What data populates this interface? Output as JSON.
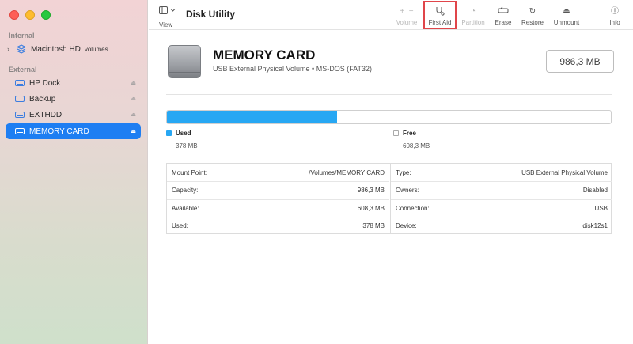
{
  "sidebar": {
    "internal_label": "Internal",
    "external_label": "External",
    "internal_items": [
      {
        "label": "Macintosh HD",
        "sub": "volumes"
      }
    ],
    "external_items": [
      {
        "label": "HP Dock"
      },
      {
        "label": "Backup"
      },
      {
        "label": "EXTHDD"
      },
      {
        "label": "MEMORY CARD",
        "selected": true
      }
    ]
  },
  "toolbar": {
    "view_label": "View",
    "title": "Disk Utility",
    "volume_label": "Volume",
    "first_aid_label": "First Aid",
    "partition_label": "Partition",
    "erase_label": "Erase",
    "restore_label": "Restore",
    "unmount_label": "Unmount",
    "info_label": "Info",
    "highlight_color": "#e0454a"
  },
  "disk": {
    "name": "MEMORY CARD",
    "subtitle": "USB External Physical Volume • MS-DOS (FAT32)",
    "size": "986,3 MB",
    "used_fraction": 0.384
  },
  "usage": {
    "used_label": "Used",
    "used_value": "378 MB",
    "used_color": "#27a7f3",
    "free_label": "Free",
    "free_value": "608,3 MB"
  },
  "details": {
    "left": [
      {
        "label": "Mount Point:",
        "value": "/Volumes/MEMORY CARD"
      },
      {
        "label": "Capacity:",
        "value": "986,3 MB"
      },
      {
        "label": "Available:",
        "value": "608,3 MB"
      },
      {
        "label": "Used:",
        "value": "378 MB"
      }
    ],
    "right": [
      {
        "label": "Type:",
        "value": "USB External Physical Volume"
      },
      {
        "label": "Owners:",
        "value": "Disabled"
      },
      {
        "label": "Connection:",
        "value": "USB"
      },
      {
        "label": "Device:",
        "value": "disk12s1"
      }
    ]
  }
}
